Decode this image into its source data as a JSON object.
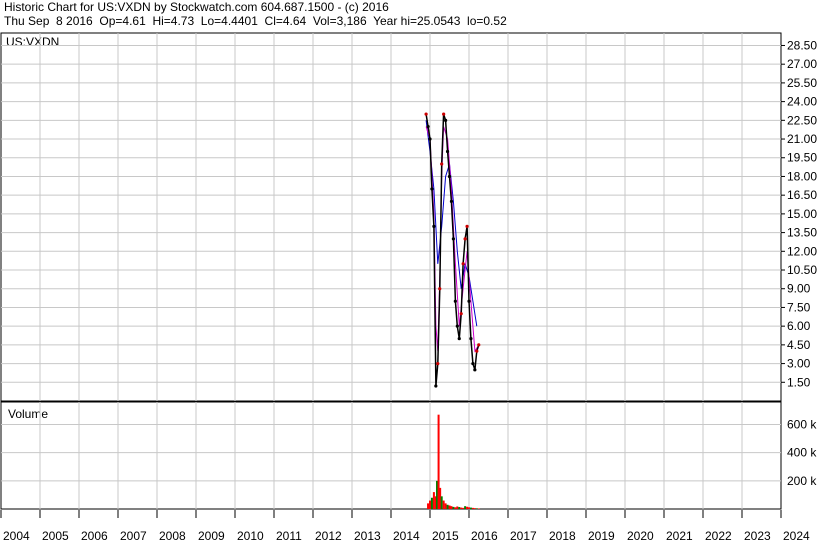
{
  "header": {
    "line1": "Historic Chart for US:VXDN by Stockwatch.com 604.687.1500 - (c) 2016",
    "line2": "Thu Sep  8 2016  Op=4.61  Hi=4.73  Lo=4.4401  Cl=4.64  Vol=3,186  Year hi=25.0543  lo=0.52"
  },
  "price_panel": {
    "label": "US:VXDN"
  },
  "volume_panel": {
    "label": "Volume"
  },
  "colors": {
    "grid": "#c8c8c8",
    "up_bar": "#cc0000",
    "down_bar": "#000000",
    "ma_fast": "#cc00cc",
    "ma_slow": "#0000cc",
    "volume_up": "#ff0000",
    "volume_down": "#008000"
  },
  "chart_data": [
    {
      "type": "line",
      "panel": "price",
      "ylim": [
        0,
        29.5
      ],
      "xlim": [
        2004,
        2024
      ],
      "y_ticks": [
        "1.50",
        "3.00",
        "4.50",
        "6.00",
        "7.50",
        "9.00",
        "10.50",
        "12.00",
        "13.50",
        "15.00",
        "16.50",
        "18.00",
        "19.50",
        "21.00",
        "22.50",
        "24.00",
        "25.50",
        "27.00",
        "28.50"
      ],
      "x_ticks": [
        "2004",
        "2005",
        "2006",
        "2007",
        "2008",
        "2009",
        "2010",
        "2011",
        "2012",
        "2013",
        "2014",
        "2015",
        "2016",
        "2017",
        "2018",
        "2019",
        "2020",
        "2021",
        "2022",
        "2023",
        "2024"
      ],
      "series": [
        {
          "name": "price",
          "points": [
            [
              2014.9,
              23
            ],
            [
              2014.95,
              22
            ],
            [
              2015.0,
              21
            ],
            [
              2015.05,
              17
            ],
            [
              2015.1,
              14
            ],
            [
              2015.15,
              1.2
            ],
            [
              2015.2,
              3
            ],
            [
              2015.25,
              9
            ],
            [
              2015.3,
              19
            ],
            [
              2015.35,
              23
            ],
            [
              2015.4,
              22.5
            ],
            [
              2015.45,
              20
            ],
            [
              2015.5,
              18
            ],
            [
              2015.55,
              16
            ],
            [
              2015.6,
              13
            ],
            [
              2015.65,
              8
            ],
            [
              2015.7,
              6
            ],
            [
              2015.75,
              5
            ],
            [
              2015.8,
              7
            ],
            [
              2015.85,
              11
            ],
            [
              2015.9,
              13
            ],
            [
              2015.95,
              14
            ],
            [
              2016.0,
              8
            ],
            [
              2016.05,
              5
            ],
            [
              2016.1,
              3
            ],
            [
              2016.15,
              2.5
            ],
            [
              2016.2,
              4
            ],
            [
              2016.25,
              4.5
            ]
          ]
        },
        {
          "name": "ma_fast",
          "points": [
            [
              2014.9,
              22
            ],
            [
              2015.0,
              21
            ],
            [
              2015.1,
              15
            ],
            [
              2015.15,
              6
            ],
            [
              2015.2,
              4
            ],
            [
              2015.25,
              10
            ],
            [
              2015.3,
              18
            ],
            [
              2015.35,
              22
            ],
            [
              2015.45,
              21
            ],
            [
              2015.55,
              17
            ],
            [
              2015.65,
              11
            ],
            [
              2015.75,
              6
            ],
            [
              2015.85,
              9
            ],
            [
              2015.95,
              12
            ],
            [
              2016.05,
              8
            ],
            [
              2016.15,
              4
            ],
            [
              2016.25,
              4.5
            ]
          ]
        },
        {
          "name": "ma_slow",
          "points": [
            [
              2014.9,
              22.5
            ],
            [
              2015.0,
              20
            ],
            [
              2015.1,
              17
            ],
            [
              2015.2,
              11
            ],
            [
              2015.3,
              14
            ],
            [
              2015.4,
              18
            ],
            [
              2015.5,
              19
            ],
            [
              2015.6,
              16
            ],
            [
              2015.7,
              12
            ],
            [
              2015.8,
              9
            ],
            [
              2015.9,
              11
            ],
            [
              2016.0,
              10
            ],
            [
              2016.1,
              8
            ],
            [
              2016.2,
              6
            ]
          ]
        }
      ]
    },
    {
      "type": "bar",
      "panel": "volume",
      "ylim": [
        0,
        760
      ],
      "y_ticks": [
        "200 k",
        "400 k",
        "600 k"
      ],
      "bars": [
        [
          2014.95,
          40
        ],
        [
          2015.0,
          60
        ],
        [
          2015.05,
          80
        ],
        [
          2015.1,
          120
        ],
        [
          2015.15,
          90
        ],
        [
          2015.18,
          200
        ],
        [
          2015.22,
          670
        ],
        [
          2015.26,
          150
        ],
        [
          2015.3,
          90
        ],
        [
          2015.35,
          60
        ],
        [
          2015.4,
          40
        ],
        [
          2015.45,
          30
        ],
        [
          2015.5,
          25
        ],
        [
          2015.55,
          20
        ],
        [
          2015.6,
          15
        ],
        [
          2015.65,
          12
        ],
        [
          2015.7,
          18
        ],
        [
          2015.75,
          14
        ],
        [
          2015.8,
          10
        ],
        [
          2015.85,
          8
        ],
        [
          2015.9,
          20
        ],
        [
          2015.95,
          16
        ],
        [
          2016.0,
          12
        ],
        [
          2016.05,
          10
        ],
        [
          2016.1,
          8
        ],
        [
          2016.15,
          6
        ],
        [
          2016.2,
          5
        ],
        [
          2016.25,
          4
        ]
      ]
    }
  ]
}
